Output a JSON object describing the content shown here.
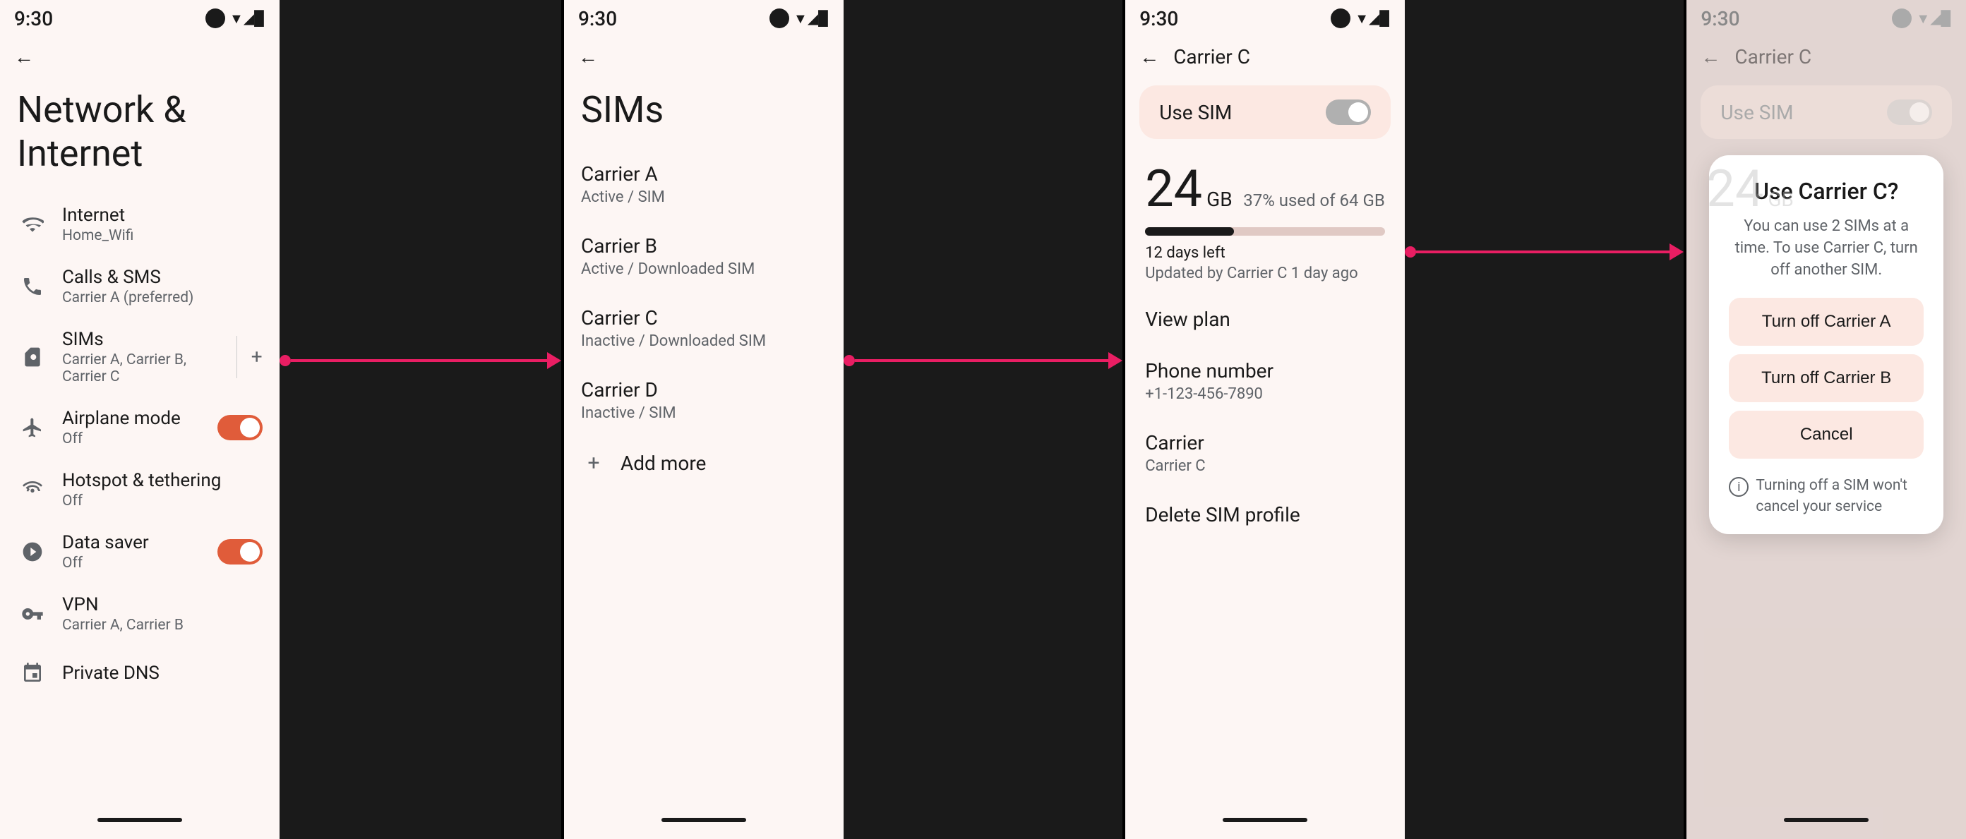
{
  "screens": {
    "screen1": {
      "status_time": "9:30",
      "title": "Network & Internet",
      "menu_items": [
        {
          "id": "internet",
          "label": "Internet",
          "sublabel": "Home_Wifi",
          "icon": "wifi",
          "has_toggle": false
        },
        {
          "id": "calls_sms",
          "label": "Calls & SMS",
          "sublabel": "Carrier A (preferred)",
          "icon": "phone",
          "has_toggle": false
        },
        {
          "id": "sims",
          "label": "SIMs",
          "sublabel": "Carrier A, Carrier B, Carrier C",
          "icon": "sim",
          "has_toggle": false,
          "has_divider_plus": true
        },
        {
          "id": "airplane",
          "label": "Airplane mode",
          "sublabel": "Off",
          "icon": "airplane",
          "has_toggle": true
        },
        {
          "id": "hotspot",
          "label": "Hotspot & tethering",
          "sublabel": "Off",
          "icon": "hotspot",
          "has_toggle": false
        },
        {
          "id": "datasaver",
          "label": "Data saver",
          "sublabel": "Off",
          "icon": "datasaver",
          "has_toggle": true
        },
        {
          "id": "vpn",
          "label": "VPN",
          "sublabel": "Carrier A, Carrier B",
          "icon": "vpn",
          "has_toggle": false
        }
      ],
      "bottom_label": "Private DNS"
    },
    "screen2": {
      "status_time": "9:30",
      "title": "SIMs",
      "carriers": [
        {
          "name": "Carrier A",
          "status": "Active / SIM"
        },
        {
          "name": "Carrier B",
          "status": "Active / Downloaded SIM"
        },
        {
          "name": "Carrier C",
          "status": "Inactive / Downloaded SIM"
        },
        {
          "name": "Carrier D",
          "status": "Inactive / SIM"
        }
      ],
      "add_more_label": "Add more"
    },
    "screen3": {
      "status_time": "9:30",
      "nav_title": "Carrier C",
      "use_sim_label": "Use SIM",
      "data_number": "24",
      "data_unit": "GB",
      "data_percent": "37% used of 64 GB",
      "data_bar_percent": 37,
      "data_days": "12 days left",
      "data_updated": "Updated by Carrier C 1 day ago",
      "detail_items": [
        {
          "id": "view_plan",
          "label": "View plan",
          "value": ""
        },
        {
          "id": "phone_number",
          "label": "Phone number",
          "value": "+1-123-456-7890"
        },
        {
          "id": "carrier",
          "label": "Carrier",
          "value": "Carrier C"
        },
        {
          "id": "delete_sim",
          "label": "Delete SIM profile",
          "value": ""
        }
      ]
    },
    "screen4": {
      "status_time": "9:30",
      "nav_title": "Carrier C",
      "use_sim_label": "Use SIM",
      "data_number": "24",
      "data_unit": "GB",
      "dialog": {
        "title": "Use Carrier C?",
        "description": "You can use 2 SIMs at a time. To use Carrier C, turn off another SIM.",
        "buttons": [
          {
            "id": "turn_off_a",
            "label": "Turn off Carrier A"
          },
          {
            "id": "turn_off_b",
            "label": "Turn off Carrier B"
          },
          {
            "id": "cancel",
            "label": "Cancel"
          }
        ],
        "note": "Turning off a SIM won't cancel your service"
      }
    }
  },
  "arrows": {
    "arrow1_label": "arrow from SIMs item to screen 2",
    "arrow2_label": "arrow from Carrier C to screen 3",
    "arrow3_label": "arrow from Use SIM toggle to screen 4"
  }
}
